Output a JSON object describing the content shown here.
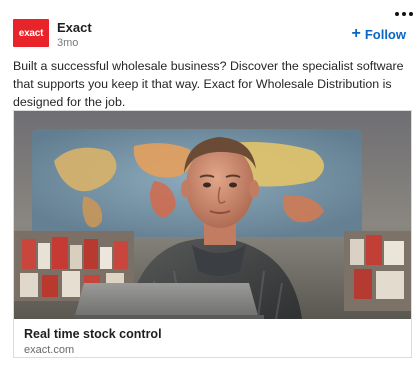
{
  "post": {
    "company": {
      "logo_text": "exact",
      "name": "Exact",
      "age": "3mo",
      "brand_color": "#e8232a"
    },
    "follow": {
      "icon": "+",
      "label": "Follow",
      "color": "#0a66c2"
    },
    "more_icon": "more-horizontal-icon",
    "text": "Built a successful wholesale business? Discover the specialist software that supports you keep it that way. Exact for Wholesale Distribution is designed for the job.",
    "link": {
      "title": "Real time stock control",
      "domain": "exact.com"
    }
  }
}
